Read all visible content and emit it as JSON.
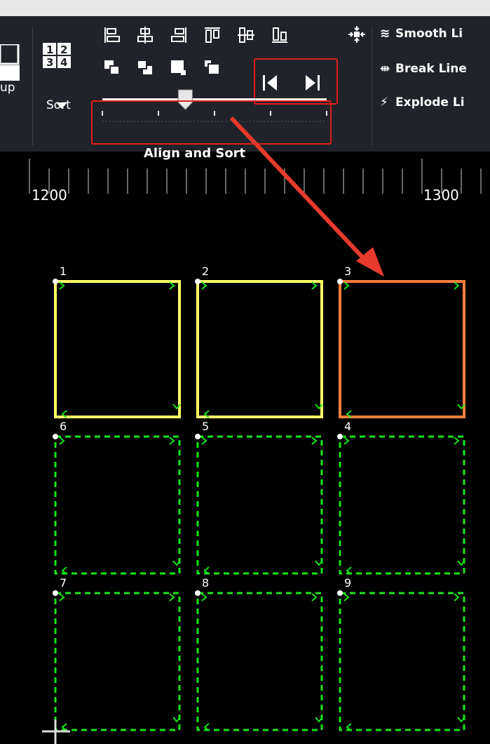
{
  "ribbon": {
    "group_label_partial": "up",
    "sort": {
      "label": "Sort",
      "digits": [
        "1",
        "2",
        "3",
        "4"
      ]
    },
    "align_sort": {
      "caption": "Align and Sort",
      "slider_value": 0.37
    },
    "commands": {
      "smooth": "Smooth Li",
      "break": "Break Line",
      "explode": "Explode Li"
    }
  },
  "ruler": {
    "labels": [
      "1200",
      "1300"
    ]
  },
  "canvas": {
    "shapes": [
      {
        "id": "1",
        "state": "yellow"
      },
      {
        "id": "2",
        "state": "yellow"
      },
      {
        "id": "3",
        "state": "orange"
      },
      {
        "id": "6",
        "state": "green"
      },
      {
        "id": "5",
        "state": "green"
      },
      {
        "id": "4",
        "state": "green"
      },
      {
        "id": "7",
        "state": "green"
      },
      {
        "id": "8",
        "state": "green"
      },
      {
        "id": "9",
        "state": "green"
      }
    ],
    "colors": {
      "yellow": "#ffff66",
      "orange": "#ff7f3c",
      "green": "#19e619",
      "arrow": "#e83b2e"
    }
  }
}
